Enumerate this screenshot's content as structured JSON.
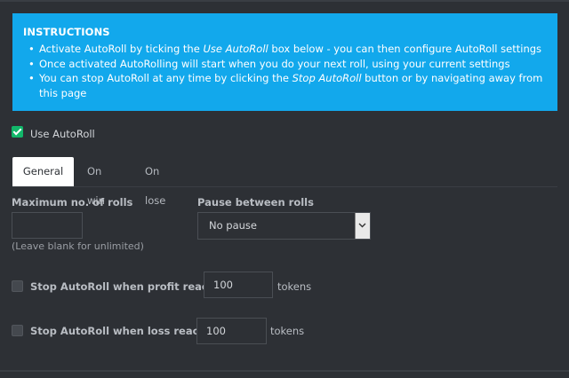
{
  "instructions": {
    "title": "INSTRUCTIONS",
    "line1_pre": "Activate AutoRoll by ticking the ",
    "line1_em": "Use AutoRoll",
    "line1_post": " box below - you can then configure AutoRoll settings",
    "line2": "Once activated AutoRolling will start when you do your next roll, using your current settings",
    "line3_pre": "You can stop AutoRoll at any time by clicking the ",
    "line3_em": "Stop AutoRoll",
    "line3_post": " button or by navigating away from this page"
  },
  "use_autoroll": {
    "label": "Use AutoRoll",
    "checked": true
  },
  "tabs": [
    {
      "label": "General",
      "active": true
    },
    {
      "label": "On win",
      "active": false
    },
    {
      "label": "On lose",
      "active": false
    }
  ],
  "general": {
    "max_rolls": {
      "label": "Maximum no. of rolls",
      "value": "",
      "hint": "(Leave blank for unlimited)"
    },
    "pause": {
      "label": "Pause between rolls",
      "selected": "No pause"
    },
    "stop_profit": {
      "label": "Stop AutoRoll when profit reaches",
      "value": "100",
      "units": "tokens",
      "checked": false
    },
    "stop_loss": {
      "label": "Stop AutoRoll when loss reaches",
      "value": "100",
      "units": "tokens",
      "checked": false
    }
  },
  "colors": {
    "accent": "#12a8ec",
    "checkbox_on": "#12b76a",
    "background": "#2d3035"
  }
}
